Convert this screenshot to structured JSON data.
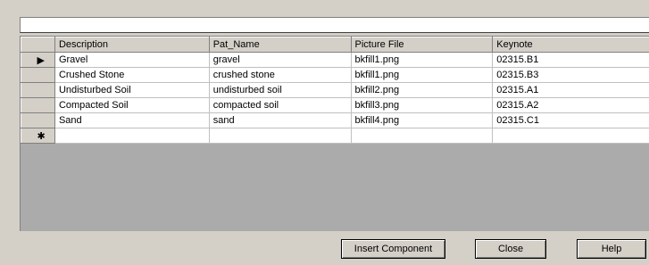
{
  "grid": {
    "columns": [
      "Description",
      "Pat_Name",
      "Picture File",
      "Keynote"
    ],
    "rows": [
      [
        "Gravel",
        "gravel",
        "bkfill1.png",
        "02315.B1"
      ],
      [
        "Crushed Stone",
        "crushed stone",
        "bkfill1.png",
        "02315.B3"
      ],
      [
        "Undisturbed Soil",
        "undisturbed soil",
        "bkfill2.png",
        "02315.A1"
      ],
      [
        "Compacted Soil",
        "compacted soil",
        "bkfill3.png",
        "02315.A2"
      ],
      [
        "Sand",
        "sand",
        "bkfill4.png",
        "02315.C1"
      ]
    ],
    "current_row_marker": "▶",
    "new_row_marker": "✱"
  },
  "buttons": {
    "insert_component": "Insert Component",
    "close": "Close",
    "help": "Help"
  }
}
